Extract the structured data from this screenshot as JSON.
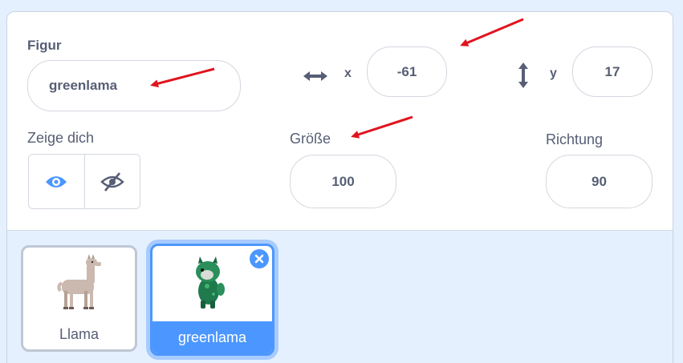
{
  "sprite_info": {
    "sprite_label": "Figur",
    "sprite_name": "greenlama",
    "x_label": "x",
    "x_value": "-61",
    "y_label": "y",
    "y_value": "17",
    "show_label": "Zeige dich",
    "size_label": "Größe",
    "size_value": "100",
    "direction_label": "Richtung",
    "direction_value": "90"
  },
  "sprites": [
    {
      "name": "Llama",
      "selected": false
    },
    {
      "name": "greenlama",
      "selected": true
    }
  ],
  "colors": {
    "accent": "#4c97ff",
    "annotation": "#e0141e",
    "text": "#575e75",
    "background": "#e5f0ff"
  },
  "icons": [
    "horizontal-arrows-icon",
    "vertical-arrows-icon",
    "eye-icon",
    "eye-hidden-icon",
    "close-icon"
  ]
}
